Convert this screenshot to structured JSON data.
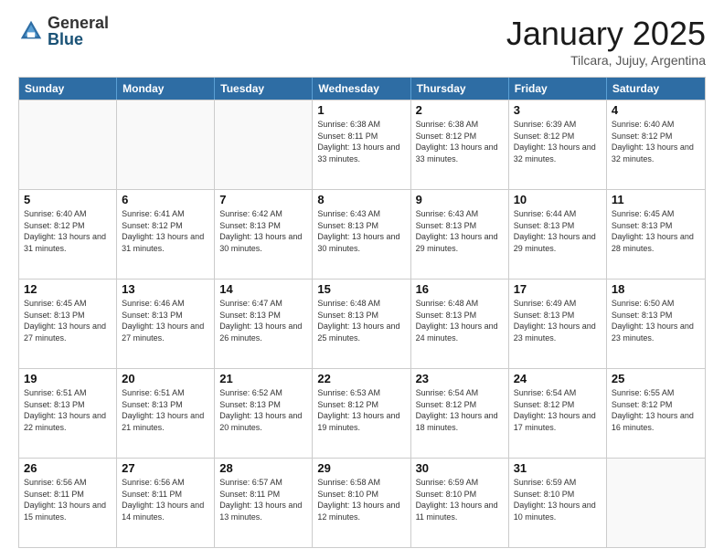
{
  "logo": {
    "general": "General",
    "blue": "Blue"
  },
  "header": {
    "month": "January 2025",
    "location": "Tilcara, Jujuy, Argentina"
  },
  "days_of_week": [
    "Sunday",
    "Monday",
    "Tuesday",
    "Wednesday",
    "Thursday",
    "Friday",
    "Saturday"
  ],
  "weeks": [
    [
      {
        "day": "",
        "info": ""
      },
      {
        "day": "",
        "info": ""
      },
      {
        "day": "",
        "info": ""
      },
      {
        "day": "1",
        "info": "Sunrise: 6:38 AM\nSunset: 8:11 PM\nDaylight: 13 hours and 33 minutes."
      },
      {
        "day": "2",
        "info": "Sunrise: 6:38 AM\nSunset: 8:12 PM\nDaylight: 13 hours and 33 minutes."
      },
      {
        "day": "3",
        "info": "Sunrise: 6:39 AM\nSunset: 8:12 PM\nDaylight: 13 hours and 32 minutes."
      },
      {
        "day": "4",
        "info": "Sunrise: 6:40 AM\nSunset: 8:12 PM\nDaylight: 13 hours and 32 minutes."
      }
    ],
    [
      {
        "day": "5",
        "info": "Sunrise: 6:40 AM\nSunset: 8:12 PM\nDaylight: 13 hours and 31 minutes."
      },
      {
        "day": "6",
        "info": "Sunrise: 6:41 AM\nSunset: 8:12 PM\nDaylight: 13 hours and 31 minutes."
      },
      {
        "day": "7",
        "info": "Sunrise: 6:42 AM\nSunset: 8:13 PM\nDaylight: 13 hours and 30 minutes."
      },
      {
        "day": "8",
        "info": "Sunrise: 6:43 AM\nSunset: 8:13 PM\nDaylight: 13 hours and 30 minutes."
      },
      {
        "day": "9",
        "info": "Sunrise: 6:43 AM\nSunset: 8:13 PM\nDaylight: 13 hours and 29 minutes."
      },
      {
        "day": "10",
        "info": "Sunrise: 6:44 AM\nSunset: 8:13 PM\nDaylight: 13 hours and 29 minutes."
      },
      {
        "day": "11",
        "info": "Sunrise: 6:45 AM\nSunset: 8:13 PM\nDaylight: 13 hours and 28 minutes."
      }
    ],
    [
      {
        "day": "12",
        "info": "Sunrise: 6:45 AM\nSunset: 8:13 PM\nDaylight: 13 hours and 27 minutes."
      },
      {
        "day": "13",
        "info": "Sunrise: 6:46 AM\nSunset: 8:13 PM\nDaylight: 13 hours and 27 minutes."
      },
      {
        "day": "14",
        "info": "Sunrise: 6:47 AM\nSunset: 8:13 PM\nDaylight: 13 hours and 26 minutes."
      },
      {
        "day": "15",
        "info": "Sunrise: 6:48 AM\nSunset: 8:13 PM\nDaylight: 13 hours and 25 minutes."
      },
      {
        "day": "16",
        "info": "Sunrise: 6:48 AM\nSunset: 8:13 PM\nDaylight: 13 hours and 24 minutes."
      },
      {
        "day": "17",
        "info": "Sunrise: 6:49 AM\nSunset: 8:13 PM\nDaylight: 13 hours and 23 minutes."
      },
      {
        "day": "18",
        "info": "Sunrise: 6:50 AM\nSunset: 8:13 PM\nDaylight: 13 hours and 23 minutes."
      }
    ],
    [
      {
        "day": "19",
        "info": "Sunrise: 6:51 AM\nSunset: 8:13 PM\nDaylight: 13 hours and 22 minutes."
      },
      {
        "day": "20",
        "info": "Sunrise: 6:51 AM\nSunset: 8:13 PM\nDaylight: 13 hours and 21 minutes."
      },
      {
        "day": "21",
        "info": "Sunrise: 6:52 AM\nSunset: 8:13 PM\nDaylight: 13 hours and 20 minutes."
      },
      {
        "day": "22",
        "info": "Sunrise: 6:53 AM\nSunset: 8:12 PM\nDaylight: 13 hours and 19 minutes."
      },
      {
        "day": "23",
        "info": "Sunrise: 6:54 AM\nSunset: 8:12 PM\nDaylight: 13 hours and 18 minutes."
      },
      {
        "day": "24",
        "info": "Sunrise: 6:54 AM\nSunset: 8:12 PM\nDaylight: 13 hours and 17 minutes."
      },
      {
        "day": "25",
        "info": "Sunrise: 6:55 AM\nSunset: 8:12 PM\nDaylight: 13 hours and 16 minutes."
      }
    ],
    [
      {
        "day": "26",
        "info": "Sunrise: 6:56 AM\nSunset: 8:11 PM\nDaylight: 13 hours and 15 minutes."
      },
      {
        "day": "27",
        "info": "Sunrise: 6:56 AM\nSunset: 8:11 PM\nDaylight: 13 hours and 14 minutes."
      },
      {
        "day": "28",
        "info": "Sunrise: 6:57 AM\nSunset: 8:11 PM\nDaylight: 13 hours and 13 minutes."
      },
      {
        "day": "29",
        "info": "Sunrise: 6:58 AM\nSunset: 8:10 PM\nDaylight: 13 hours and 12 minutes."
      },
      {
        "day": "30",
        "info": "Sunrise: 6:59 AM\nSunset: 8:10 PM\nDaylight: 13 hours and 11 minutes."
      },
      {
        "day": "31",
        "info": "Sunrise: 6:59 AM\nSunset: 8:10 PM\nDaylight: 13 hours and 10 minutes."
      },
      {
        "day": "",
        "info": ""
      }
    ]
  ]
}
